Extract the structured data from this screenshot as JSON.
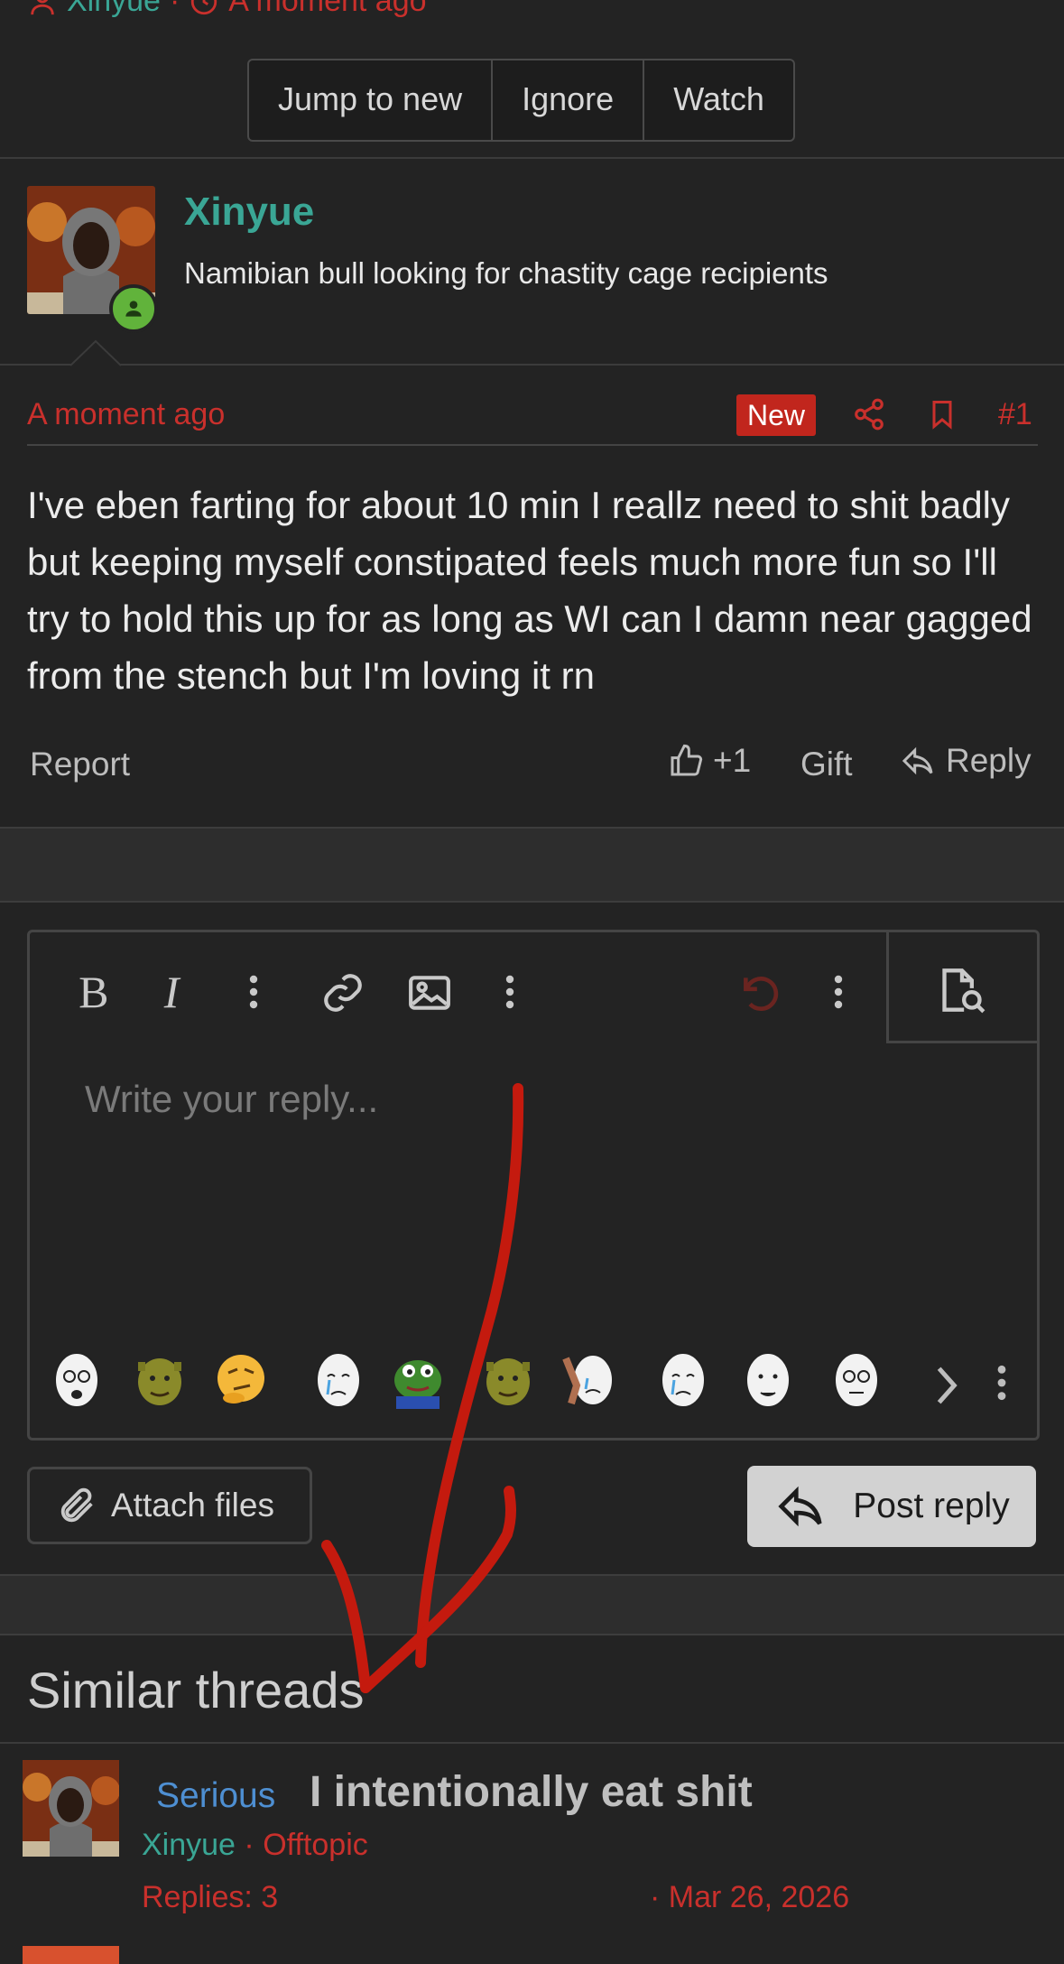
{
  "thread_meta": {
    "author": "Xinyue",
    "separator": "·",
    "time": "A moment ago"
  },
  "thread_actions": [
    "Jump to new",
    "Ignore",
    "Watch"
  ],
  "post": {
    "author": "Xinyue",
    "user_title": "Namibian bull looking for chastity cage recipients",
    "date": "A moment ago",
    "badge": "New",
    "number": "#1",
    "body": "I've eben farting for about 10 min I reallz need to shit badly but keeping myself constipated feels much more fun so I'll try to hold this up for as long as WI can I damn near gagged from the stench but I'm loving it rn",
    "report_label": "Report",
    "like_count": "+1",
    "gift_label": "Gift",
    "reply_label": "Reply"
  },
  "editor": {
    "placeholder": "Write your reply...",
    "attach_label": "Attach files",
    "post_reply_label": "Post reply",
    "smilies": [
      "wojak-glasses",
      "shrek",
      "thinking",
      "crying-wojak",
      "pepe",
      "shrek",
      "crying-wojak-hands",
      "crying-wojak",
      "wojak",
      "wojak-glasses"
    ]
  },
  "similar": {
    "heading": "Similar threads",
    "threads": [
      {
        "prefix": "Serious",
        "title": "I intentionally eat shit",
        "author": "Xinyue",
        "separator": "·",
        "forum": "Offtopic",
        "replies": "Replies: 3",
        "date": "· Mar 26, 2026"
      }
    ]
  },
  "colors": {
    "background": "#232323",
    "accent_red": "#c9302c",
    "username_teal": "#3aa695",
    "prefix_blue": "#4e8fd2",
    "annotation_red": "#c41a0e"
  },
  "icons": [
    "user-icon",
    "clock-icon",
    "share-icon",
    "bookmark-icon",
    "thumbs-up-icon",
    "reply-icon",
    "bold-icon",
    "italic-icon",
    "more-icon",
    "link-icon",
    "image-icon",
    "undo-icon",
    "preview-icon",
    "paperclip-icon",
    "chevron-right-icon"
  ]
}
